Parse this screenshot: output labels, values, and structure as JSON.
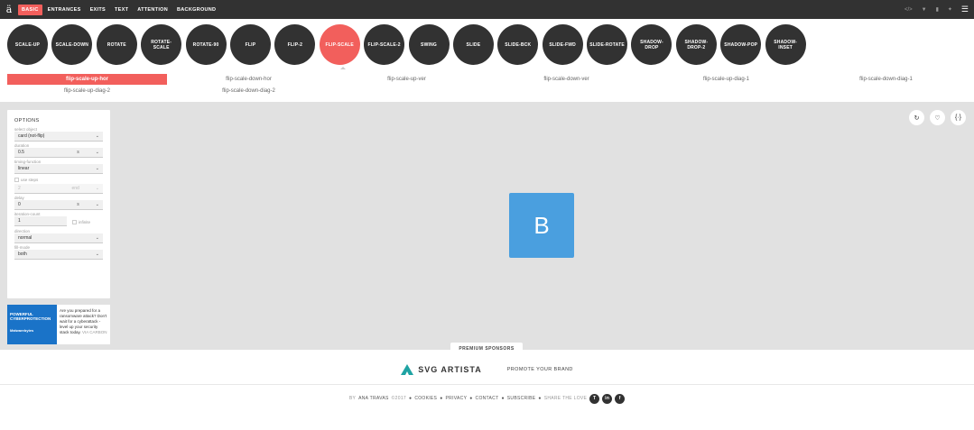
{
  "topbar": {
    "logo": "ä",
    "tabs": [
      {
        "label": "BASIC",
        "active": true
      },
      {
        "label": "ENTRANCES",
        "active": false
      },
      {
        "label": "EXITS",
        "active": false
      },
      {
        "label": "TEXT",
        "active": false
      },
      {
        "label": "ATTENTION",
        "active": false
      },
      {
        "label": "BACKGROUND",
        "active": false
      }
    ],
    "right_icons": [
      "code-icon",
      "filter-icon",
      "download-icon",
      "star-icon"
    ],
    "menu_icon": "☰"
  },
  "animations": [
    {
      "label": "SCALE-UP"
    },
    {
      "label": "SCALE-DOWN"
    },
    {
      "label": "ROTATE"
    },
    {
      "label": "ROTATE-SCALE"
    },
    {
      "label": "ROTATE-90"
    },
    {
      "label": "FLIP"
    },
    {
      "label": "FLIP-2"
    },
    {
      "label": "FLIP-SCALE",
      "active": true
    },
    {
      "label": "FLIP-SCALE-2"
    },
    {
      "label": "SWING"
    },
    {
      "label": "SLIDE"
    },
    {
      "label": "SLIDE-BCK"
    },
    {
      "label": "SLIDE-FWD"
    },
    {
      "label": "SLIDE-ROTATE"
    },
    {
      "label": "SHADOW-DROP"
    },
    {
      "label": "SHADOW-DROP-2"
    },
    {
      "label": "SHADOW-POP"
    },
    {
      "label": "SHADOW-INSET"
    }
  ],
  "variants": [
    {
      "label": "flip-scale-up-hor",
      "active": true
    },
    {
      "label": "flip-scale-down-hor"
    },
    {
      "label": "flip-scale-up-ver"
    },
    {
      "label": "flip-scale-down-ver"
    },
    {
      "label": "flip-scale-up-diag-1"
    },
    {
      "label": "flip-scale-down-diag-1"
    },
    {
      "label": "flip-scale-up-diag-2"
    },
    {
      "label": "flip-scale-down-diag-2"
    }
  ],
  "options": {
    "title": "OPTIONS",
    "select_object_label": "select object",
    "select_object_value": "card (not-flip)",
    "duration_label": "duration",
    "duration_value": "0.5",
    "duration_unit": "s",
    "timing_label": "timing-function",
    "timing_value": "linear",
    "use_steps_label": "use steps",
    "steps_value": "2",
    "steps_unit": "end",
    "delay_label": "delay",
    "delay_value": "0",
    "delay_unit": "s",
    "iteration_label": "iteration-count",
    "iteration_value": "1",
    "infinite_label": "infinite",
    "direction_label": "direction",
    "direction_value": "normal",
    "fill_label": "fill-mode",
    "fill_value": "both"
  },
  "ad": {
    "img_line1": "POWERFUL",
    "img_line2": "CYBERPROTECTION",
    "img_brand": "Malwarebytes",
    "text": "Are you prepared for a ransomware attack? Don't wait for a cyberattack - level up your security stack today.",
    "via": "VIA CARBON"
  },
  "stage": {
    "demo_letter": "B",
    "buttons": [
      "refresh-icon",
      "heart-icon",
      "code-icon"
    ]
  },
  "sponsor": {
    "tab": "PREMIUM SPONSORS",
    "brand": "SVG ARTISTA",
    "promote": "PROMOTE YOUR BRAND"
  },
  "footer": {
    "by": "BY",
    "author": "ANA TRAVAS",
    "year": "©2017",
    "cookies": "COOKIES",
    "privacy": "PRIVACY",
    "contact": "CONTACT",
    "subscribe": "SUBSCRIBE",
    "share": "SHARE THE LOVE",
    "social": [
      "T",
      "in",
      "f"
    ]
  },
  "colors": {
    "accent": "#f25f5c",
    "dark": "#323232",
    "demo": "#4a9fdf",
    "stage": "#e1e1e1"
  }
}
